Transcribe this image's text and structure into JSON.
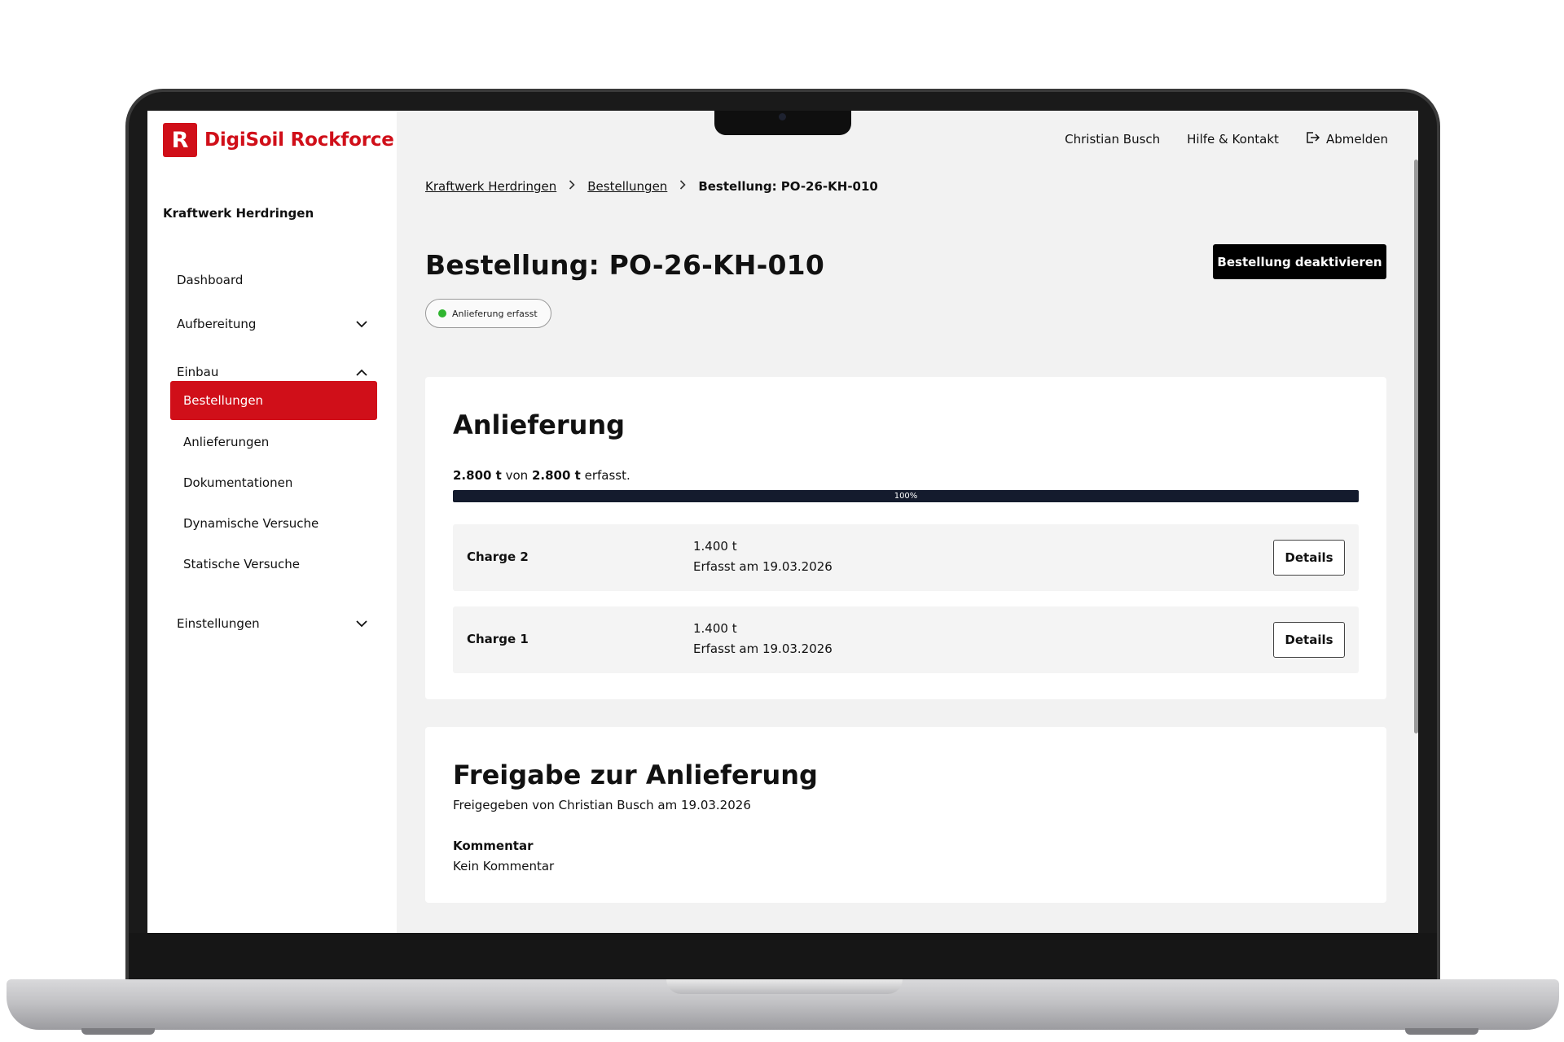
{
  "app": {
    "logo_letter": "R",
    "logo_text": "DigiSoil Rockforce",
    "brand_color": "#d00f19"
  },
  "sidebar": {
    "site_name": "Kraftwerk Herdringen",
    "items": [
      {
        "label": "Dashboard"
      },
      {
        "label": "Aufbereitung",
        "icon": "chevron-down-icon"
      },
      {
        "label": "Einbau",
        "icon": "chevron-up-icon"
      },
      {
        "label": "Einstellungen",
        "icon": "chevron-down-icon"
      }
    ],
    "subitems": [
      {
        "label": "Bestellungen",
        "active": true
      },
      {
        "label": "Anlieferungen"
      },
      {
        "label": "Dokumentationen"
      },
      {
        "label": "Dynamische Versuche"
      },
      {
        "label": "Statische Versuche"
      }
    ]
  },
  "topnav": {
    "user": "Christian Busch",
    "help": "Hilfe & Kontakt",
    "logout": "Abmelden",
    "logout_icon": "logout-icon"
  },
  "breadcrumb": {
    "items": [
      "Kraftwerk Herdringen",
      "Bestellungen"
    ],
    "current": "Bestellung: PO-26-KH-010"
  },
  "page": {
    "title": "Bestellung: PO-26-KH-010",
    "action_label": "Bestellung deaktivieren",
    "status": "Anlieferung erfasst",
    "status_color": "#2fb52f"
  },
  "delivery": {
    "title": "Anlieferung",
    "captured_amount": "2.800 t",
    "von": "von",
    "total_amount": "2.800 t",
    "suffix": "erfasst.",
    "progress_percent": 100,
    "progress_label": "100%",
    "charges": [
      {
        "name": "Charge 2",
        "qty": "1.400 t",
        "date": "Erfasst am 19.03.2026",
        "button": "Details"
      },
      {
        "name": "Charge 1",
        "qty": "1.400 t",
        "date": "Erfasst am 19.03.2026",
        "button": "Details"
      }
    ]
  },
  "release": {
    "title": "Freigabe zur Anlieferung",
    "subtitle": "Freigegeben von Christian Busch am 19.03.2026",
    "comment_label": "Kommentar",
    "comment_value": "Kein Kommentar"
  }
}
